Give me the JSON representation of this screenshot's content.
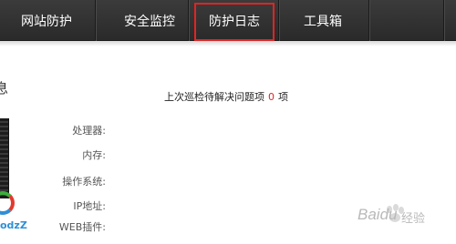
{
  "nav": {
    "items": [
      {
        "label": "网站防护"
      },
      {
        "label": "安全监控"
      },
      {
        "label": "防护日志"
      },
      {
        "label": "工具箱"
      }
    ]
  },
  "section": {
    "title": "息"
  },
  "pending": {
    "prefix": "上次巡检待解决问题项",
    "count": "0",
    "suffix": "项"
  },
  "server_info": {
    "labels": [
      "处理器:",
      "内存:",
      "操作系统:",
      "IP地址:",
      "WEB插件:"
    ]
  },
  "logo": {
    "text": "odzZ"
  },
  "watermark": {
    "text": "Baidu",
    "sub": "经验"
  },
  "colors": {
    "nav_bg": "#2f2f2f",
    "highlight": "#e02424",
    "accent_red": "#e02424"
  }
}
